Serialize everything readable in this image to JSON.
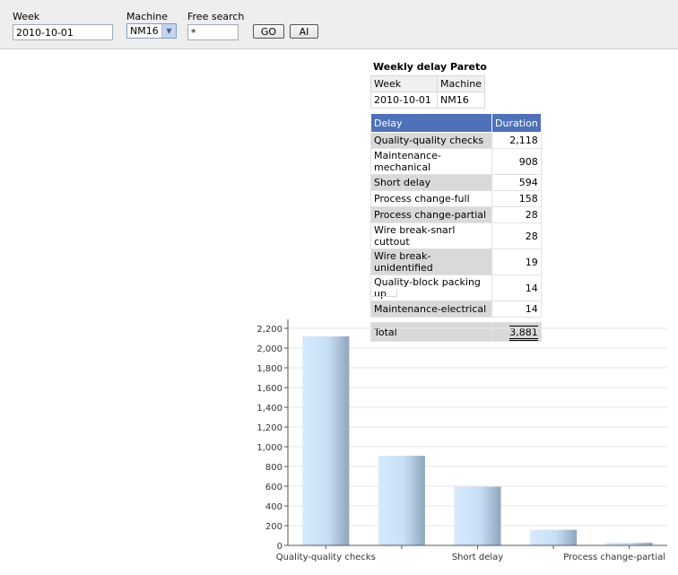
{
  "filters": {
    "week_label": "Week",
    "week_value": "2010-10-01",
    "machine_label": "Machine",
    "machine_value": "NM16",
    "search_label": "Free search",
    "search_value": "*",
    "go_label": "GO",
    "ai_label": "AI"
  },
  "report": {
    "title": "Weekly delay Pareto",
    "meta_headers": [
      "Week",
      "Machine"
    ],
    "meta_values": [
      "2010-10-01",
      "NM16"
    ],
    "columns": [
      "Delay",
      "Duration"
    ],
    "rows": [
      {
        "delay": "Quality-quality checks",
        "duration": "2,118"
      },
      {
        "delay": "Maintenance-mechanical",
        "duration": "908"
      },
      {
        "delay": "Short delay",
        "duration": "594"
      },
      {
        "delay": "Process change-full",
        "duration": "158"
      },
      {
        "delay": "Process change-partial",
        "duration": "28"
      },
      {
        "delay": "Wire break-snarl cuttout",
        "duration": "28"
      },
      {
        "delay": "Wire break-unidentified",
        "duration": "19"
      },
      {
        "delay": "Quality-block packing up",
        "duration": "14"
      },
      {
        "delay": "Maintenance-electrical",
        "duration": "14"
      }
    ],
    "total_label": "Total",
    "total_value": "3,881"
  },
  "chart_data": {
    "type": "bar",
    "categories": [
      "Quality-quality checks",
      "Maintenance-mechanical",
      "Short delay",
      "Process change-full",
      "Process change-partial"
    ],
    "values": [
      2118,
      908,
      594,
      158,
      28
    ],
    "x_tick_labels": [
      "Quality-quality checks",
      "",
      "Short delay",
      "",
      "Process change-partial"
    ],
    "ylim": [
      0,
      2200
    ],
    "yticks": [
      0,
      200,
      400,
      600,
      800,
      1000,
      1200,
      1400,
      1600,
      1800,
      2000,
      2200
    ],
    "ytick_labels": [
      "0",
      "200",
      "400",
      "600",
      "800",
      "1,000",
      "1,200",
      "1,400",
      "1,600",
      "1,800",
      "2,000",
      "2,200"
    ],
    "grid": true,
    "colors": {
      "bar_light": "#d6eafc",
      "bar_dark": "#8ea5bd",
      "grid": "#e6e6e6",
      "axis": "#555555"
    }
  }
}
